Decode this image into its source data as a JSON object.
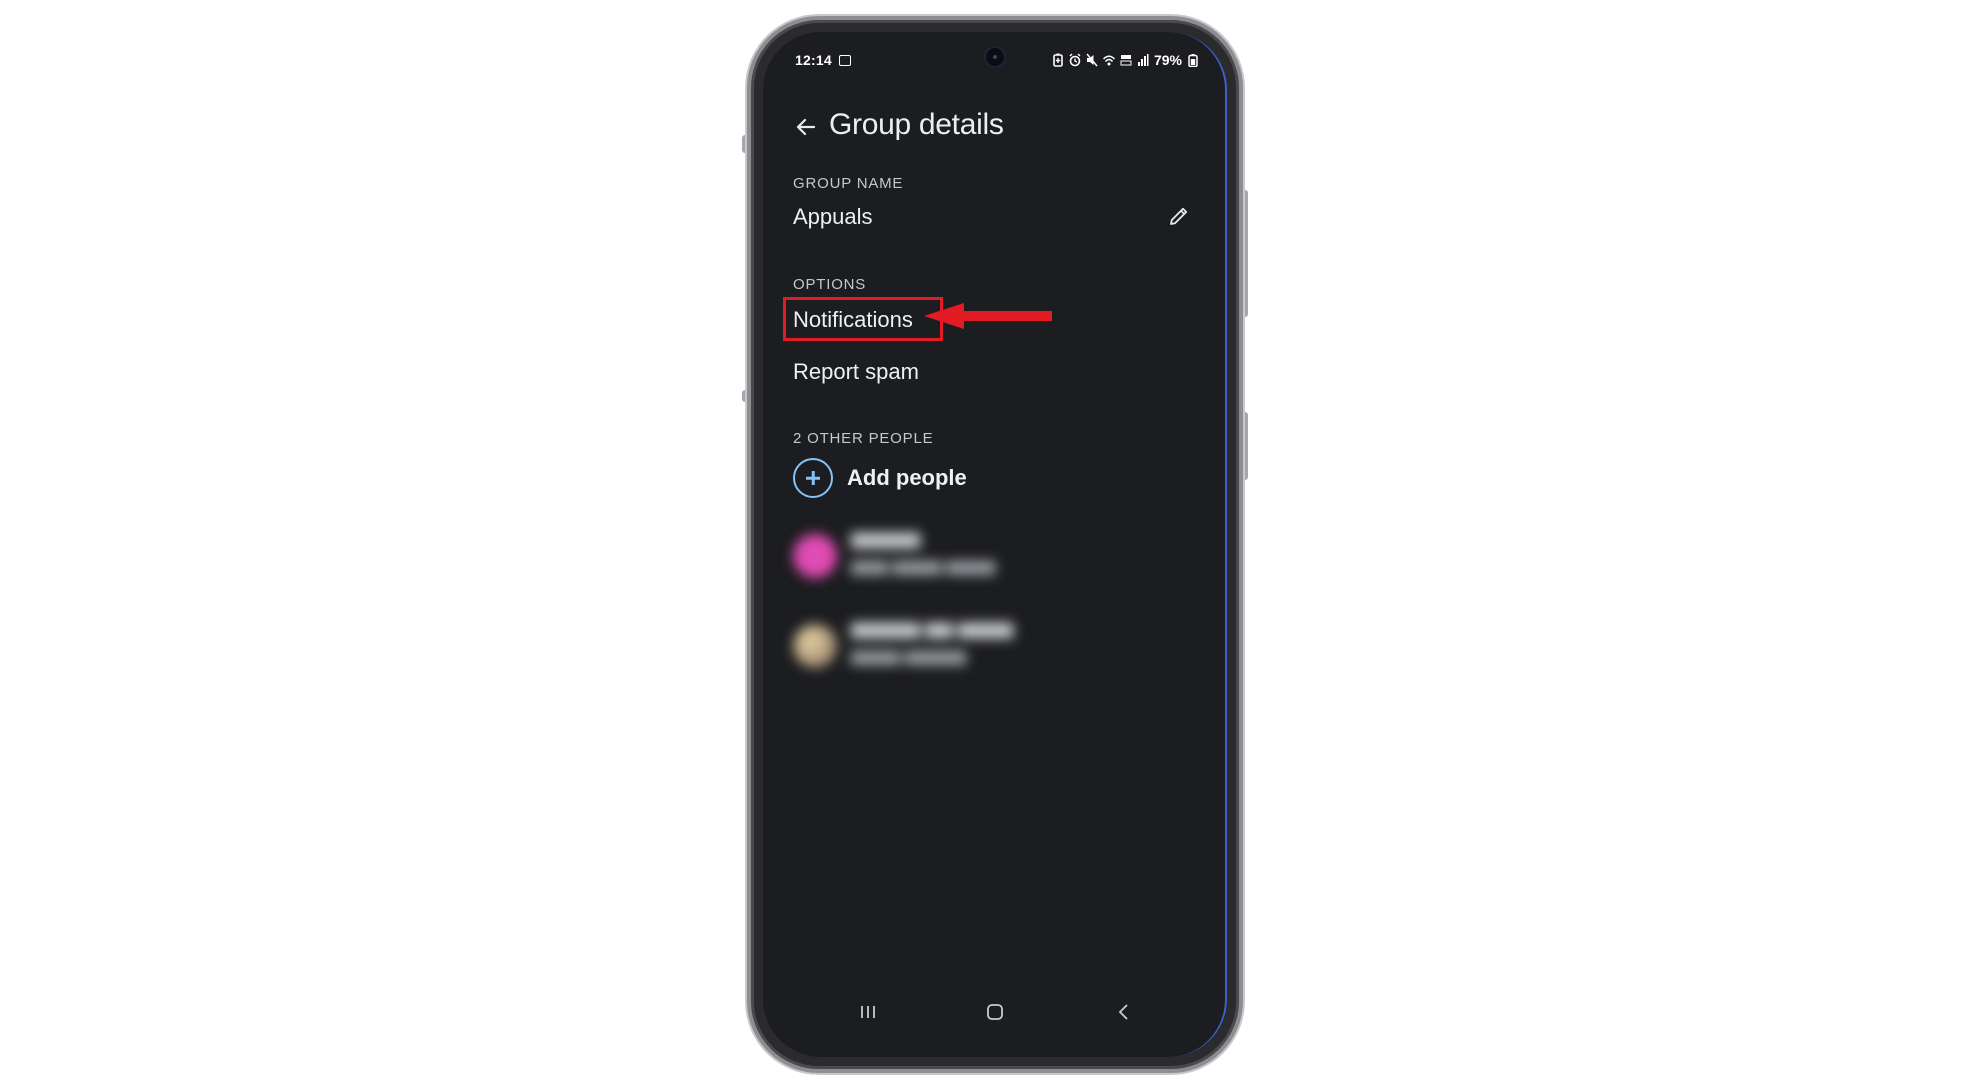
{
  "status_bar": {
    "time": "12:14",
    "battery_percent": "79%",
    "icons": [
      "gallery-icon",
      "battery-saver-icon",
      "alarm-icon",
      "mute-icon",
      "wifi-icon",
      "volte-icon",
      "signal-icon",
      "battery-icon"
    ]
  },
  "header": {
    "title": "Group details"
  },
  "group_name": {
    "label": "GROUP NAME",
    "value": "Appuals"
  },
  "options": {
    "label": "OPTIONS",
    "items": [
      {
        "label": "Notifications",
        "highlighted": true
      },
      {
        "label": "Report spam",
        "highlighted": false
      }
    ]
  },
  "people": {
    "label": "2 OTHER PEOPLE",
    "add_label": "Add people",
    "accent_color": "#82c4f5"
  },
  "annotation": {
    "highlight_color": "#e21b24"
  },
  "colors": {
    "screen_bg": "#1c1d20",
    "text": "#eef0f3"
  }
}
